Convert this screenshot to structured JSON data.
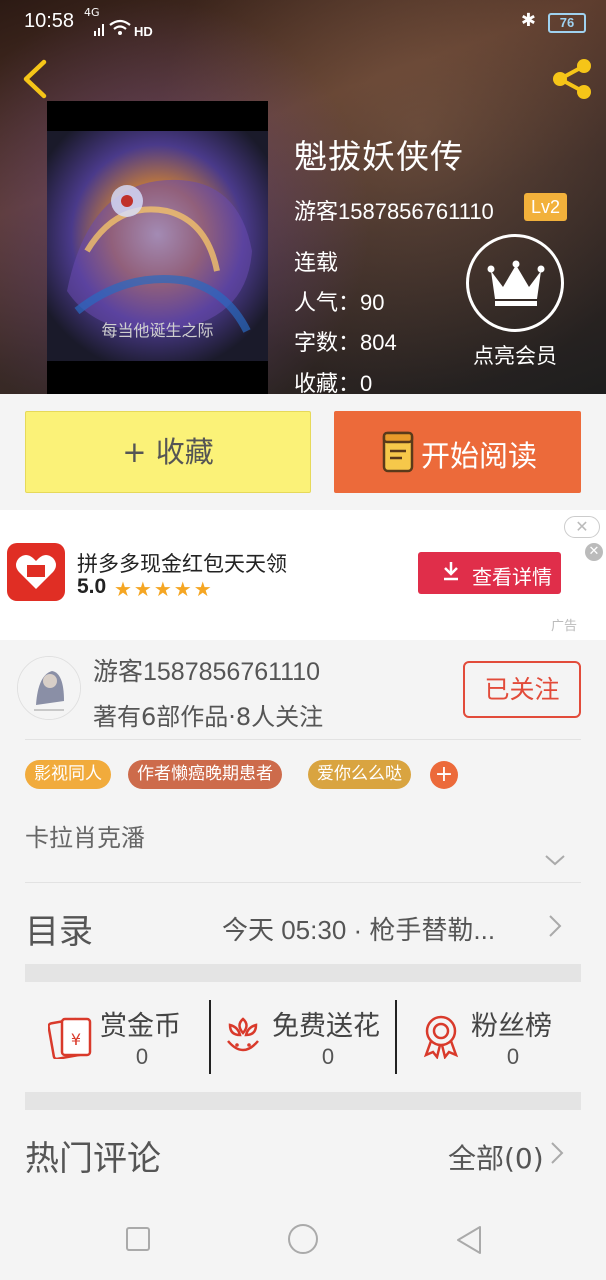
{
  "status_bar": {
    "time": "10:58",
    "network": "4G",
    "wifi": "HD",
    "battery": "76"
  },
  "book": {
    "title": "魁拔妖侠传",
    "author": "游客1587856761110",
    "level": "Lv2",
    "status": "连载",
    "popularity": "人气：90",
    "word_count": "字数：804",
    "favorites": "收藏：0",
    "cover_caption": "每当他诞生之际"
  },
  "vip": {
    "label": "点亮会员"
  },
  "actions": {
    "collect": "+ 收藏",
    "read": "开始阅读"
  },
  "ad": {
    "title": "拼多多现金红包天天领",
    "rating": "5.0",
    "stars": "★★★★★",
    "button": "查看详情",
    "tag": "广告",
    "close": "✕"
  },
  "author_info": {
    "name": "游客1587856761110",
    "stats": "著有6部作品·8人关注",
    "follow_label": "已关注"
  },
  "tags": [
    "影视同人",
    "作者懒癌晚期患者",
    "爱你么么哒"
  ],
  "tag_add": "+",
  "description": "卡拉肖克潘",
  "toc": {
    "label": "目录",
    "latest": "今天 05:30 · 枪手替勒..."
  },
  "stats": [
    {
      "label": "赏金币",
      "value": "0"
    },
    {
      "label": "免费送花",
      "value": "0"
    },
    {
      "label": "粉丝榜",
      "value": "0"
    }
  ],
  "comments": {
    "label": "热门评论",
    "all": "全部(0)"
  },
  "colors": {
    "accent_orange": "#ec6a3a",
    "collect_yellow": "#fbf278",
    "follow_red": "#e24b3a",
    "level_badge": "#f2b13b",
    "icon_red": "#d93a2b"
  }
}
